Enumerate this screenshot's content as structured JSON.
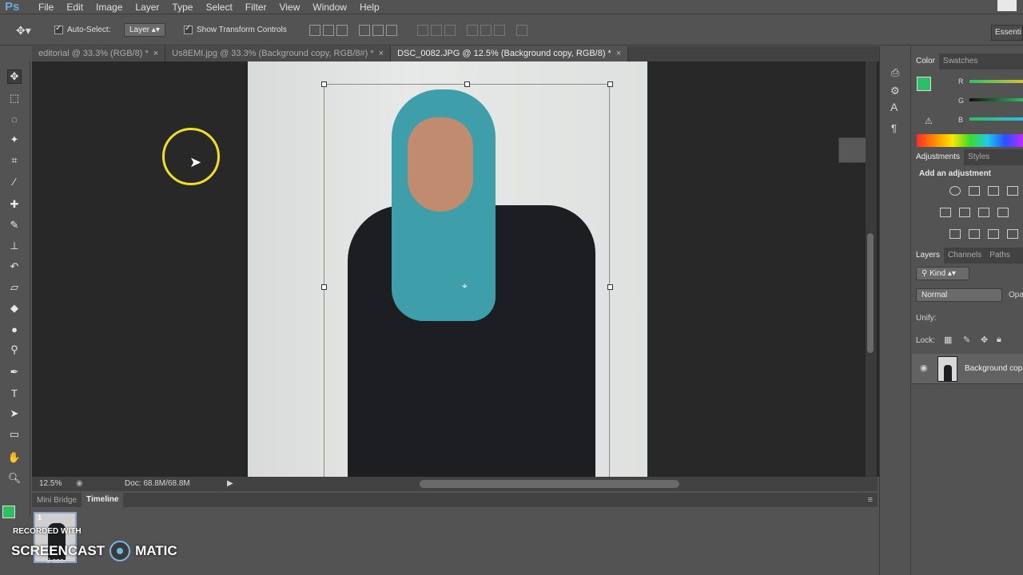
{
  "app": {
    "logo": "Ps"
  },
  "menu": [
    "File",
    "Edit",
    "Image",
    "Layer",
    "Type",
    "Select",
    "Filter",
    "View",
    "Window",
    "Help"
  ],
  "options_bar": {
    "auto_select_label": "Auto-Select:",
    "auto_select_value": "Layer",
    "transform_controls_label": "Show Transform Controls",
    "workspace": "Essenti"
  },
  "tabs": [
    {
      "label": "editorial @ 33.3% (RGB/8) *",
      "active": false
    },
    {
      "label": "Us8EMI.jpg @ 33.3% (Background copy, RGB/8#) *",
      "active": false
    },
    {
      "label": "DSC_0082.JPG @ 12.5% (Background copy, RGB/8) *",
      "active": true
    }
  ],
  "status": {
    "zoom": "12.5%",
    "doc": "Doc: 68.8M/68.8M"
  },
  "bottom_panel": {
    "tabs": [
      "Mini Bridge",
      "Timeline"
    ],
    "frame_number": "1",
    "frame_delay": "0 sec."
  },
  "watermark": {
    "line1": "RECORDED WITH",
    "brand_left": "SCREENCAST",
    "brand_right": "MATIC"
  },
  "right_panels": {
    "color_tabs": [
      "Color",
      "Swatches"
    ],
    "channel_labels": [
      "R",
      "G",
      "B"
    ],
    "adjust_tabs": [
      "Adjustments",
      "Styles"
    ],
    "adjust_title": "Add an adjustment",
    "layers_tabs": [
      "Layers",
      "Channels",
      "Paths"
    ],
    "kind_label": "Kind",
    "blend_mode": "Normal",
    "opacity_label": "Opa",
    "unify_label": "Unify:",
    "lock_label": "Lock:",
    "layer_name": "Background cop"
  },
  "colors": {
    "foreground": "#2dbf63",
    "accent_tab": "#8aa4c8",
    "cursor_ring": "#f0e020"
  }
}
